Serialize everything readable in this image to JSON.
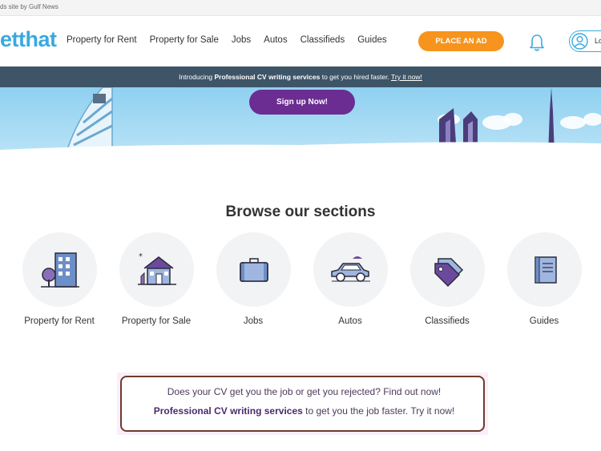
{
  "topstrip": {
    "text": "ds site by Gulf News"
  },
  "header": {
    "logo": "etthat",
    "nav": [
      "Property for Rent",
      "Property for Sale",
      "Jobs",
      "Autos",
      "Classifieds",
      "Guides"
    ],
    "place_ad": "PLACE AN AD",
    "login": "Lo"
  },
  "promo_bar": {
    "intro": "Introducing",
    "highlight": "Professional CV writing services",
    "rest": "to get you hired faster.",
    "link": "Try it now!"
  },
  "hero": {
    "signup": "Sign up Now!"
  },
  "browse": {
    "title": "Browse our sections",
    "sections": [
      {
        "label": "Property for Rent",
        "icon": "building-icon"
      },
      {
        "label": "Property for Sale",
        "icon": "house-icon"
      },
      {
        "label": "Jobs",
        "icon": "briefcase-icon"
      },
      {
        "label": "Autos",
        "icon": "car-icon"
      },
      {
        "label": "Classifieds",
        "icon": "tag-icon"
      },
      {
        "label": "Guides",
        "icon": "book-icon"
      }
    ]
  },
  "cv_promo": {
    "line1": "Does your CV get you the job or get you rejected? Find out now!",
    "highlight": "Professional CV writing services",
    "line2_rest": "to get you the job faster. Try it now!"
  },
  "colors": {
    "brand_blue": "#3aa9e0",
    "accent_orange": "#f7941d",
    "purple": "#6b2d91",
    "bar": "#3e5568"
  }
}
